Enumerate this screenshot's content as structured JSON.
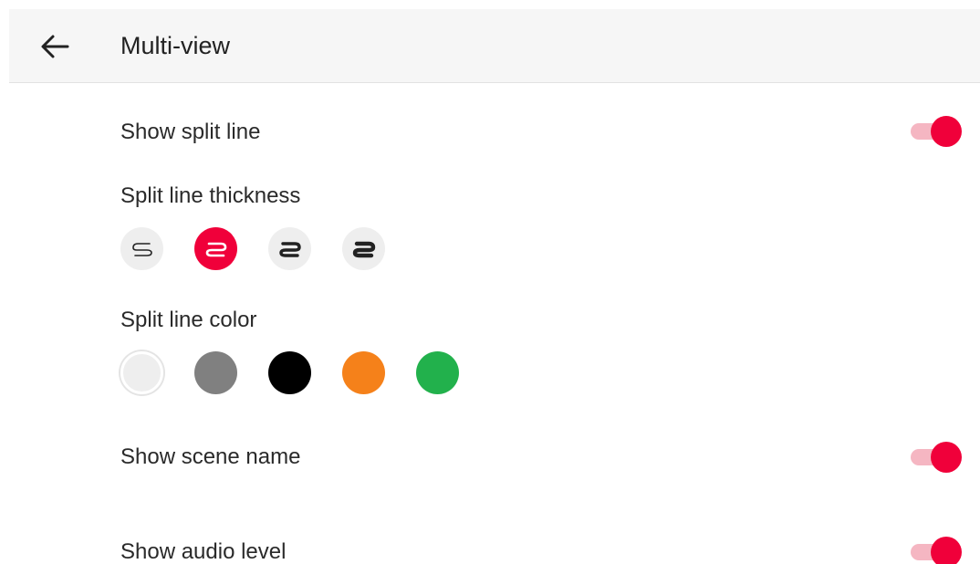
{
  "header": {
    "title": "Multi-view"
  },
  "settings": {
    "show_split_line": {
      "label": "Show split line",
      "enabled": true
    },
    "split_line_thickness": {
      "label": "Split line thickness",
      "options": [
        {
          "stroke": 1.6,
          "selected": false
        },
        {
          "stroke": 2.6,
          "selected": true
        },
        {
          "stroke": 3.4,
          "selected": false
        },
        {
          "stroke": 4.4,
          "selected": false
        }
      ]
    },
    "split_line_color": {
      "label": "Split line color",
      "options": [
        {
          "color": "#eeeeee"
        },
        {
          "color": "#808080"
        },
        {
          "color": "#000000"
        },
        {
          "color": "#f5811a"
        },
        {
          "color": "#22b14c"
        }
      ]
    },
    "show_scene_name": {
      "label": "Show scene name",
      "enabled": true
    },
    "show_audio_level": {
      "label": "Show audio level",
      "enabled": true
    }
  },
  "colors": {
    "accent": "#f0003a",
    "toggle_track": "#f5b6c2",
    "chip_bg": "#eeeeee"
  }
}
